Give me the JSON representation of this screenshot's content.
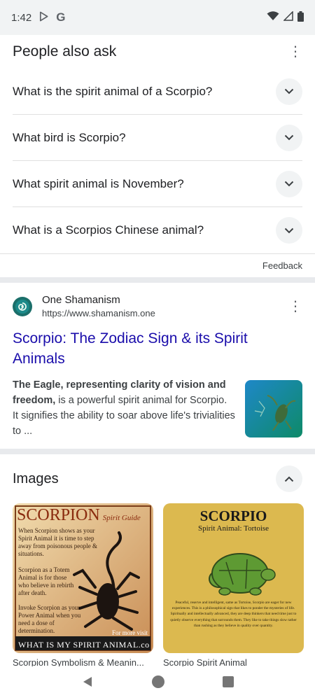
{
  "status_bar": {
    "time": "1:42",
    "g_letter": "G"
  },
  "people_also_ask": {
    "title": "People also ask",
    "questions": [
      "What is the spirit animal of a Scorpio?",
      "What bird is Scorpio?",
      "What spirit animal is November?",
      "What is a Scorpios Chinese animal?"
    ],
    "feedback": "Feedback"
  },
  "result": {
    "source_name": "One Shamanism",
    "source_url": "https://www.shamanism.one",
    "title": "Scorpio: The Zodiac Sign & its Spirit Animals",
    "snippet_bold": "The Eagle, representing clarity of vision and freedom,",
    "snippet_rest": " is a powerful spirit animal for Scorpio. It signifies the ability to soar above life's trivialities to ..."
  },
  "images": {
    "title": "Images",
    "items": [
      {
        "caption": "Scorpion Symbolism & Meanin...",
        "img_heading": "SCORPION",
        "img_sub": "Spirit Guide",
        "line1": "When Scorpion shows as your Spirit Animal it is time to step away from poisonous people & situations.",
        "line2": "Scorpion as a Totem Animal is for those who believe in rebirth after death.",
        "line3": "Invoke Scorpion as your Power Animal when you need a dose of determination.",
        "more": "For more visit",
        "footer": "WHAT IS MY SPIRIT ANIMAL.co"
      },
      {
        "caption": "Scorpio Spirit Animal",
        "img_heading": "SCORPIO",
        "img_sub": "Spirit Animal: Tortoise",
        "body": "Peaceful, reserve and intelligent, same as Tortoise, Scorpio are eager for new experiences. This is a philosophical sign that likes to ponder the mysteries of life. Spiritually and intellectually advanced, they are deep thinkers that need time just to quietly observe everything that surrounds them. They like to take things slow rather than rushing as they believe in quality over quantity."
      }
    ]
  },
  "colors": {
    "link": "#1a0dab",
    "status_bg": "#f1f3f4",
    "divider": "#e8eaed"
  }
}
